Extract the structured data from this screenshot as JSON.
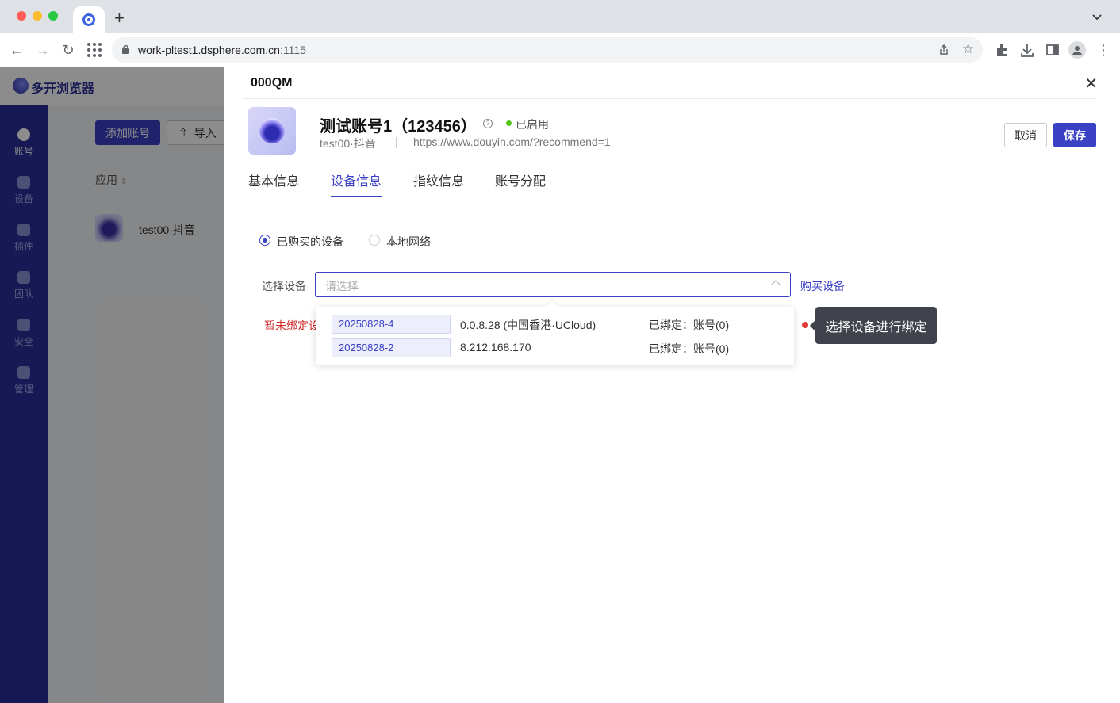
{
  "browser": {
    "url_host": "work-pltest1.dsphere.com.cn",
    "url_port": ":1115"
  },
  "app": {
    "logo_text": "多开浏览器",
    "nav": [
      {
        "label": "账号",
        "icon": "user-icon",
        "active": true
      },
      {
        "label": "设备",
        "icon": "wifi-icon",
        "active": false
      },
      {
        "label": "插件",
        "icon": "plugin-icon",
        "active": false
      },
      {
        "label": "团队",
        "icon": "team-icon",
        "active": false
      },
      {
        "label": "安全",
        "icon": "shield-icon",
        "active": false
      },
      {
        "label": "管理",
        "icon": "settings-icon",
        "active": false
      }
    ],
    "add_account": "添加账号",
    "import": "导入",
    "column_app": "应用",
    "row_name": "test00·抖音"
  },
  "drawer": {
    "title": "000QM",
    "close": "✕",
    "account_name": "测试账号1（123456）",
    "help": "?",
    "status": "已启用",
    "platform": "test00·抖音",
    "url": "https://www.douyin.com/?recommend=1",
    "cancel": "取消",
    "save": "保存",
    "tabs": [
      "基本信息",
      "设备信息",
      "指纹信息",
      "账号分配"
    ],
    "active_tab": "设备信息",
    "radio_options": [
      "已购买的设备",
      "本地网络"
    ],
    "radio_selected": "已购买的设备",
    "field_label": "选择设备",
    "select_placeholder": "请选择",
    "buy_link": "购买设备",
    "unbound_text": "暂未绑定设",
    "options": [
      {
        "tag": "20250828-4",
        "ip": "0.0.8.28 (中国香港·UCloud)",
        "bound": "已绑定：账号(0)"
      },
      {
        "tag": "20250828-2",
        "ip": "8.212.168.170",
        "bound": "已绑定：账号(0)"
      }
    ],
    "tooltip": "选择设备进行绑定"
  },
  "colors": {
    "accent": "#3b41c5",
    "sidebar": "#2b2f9a",
    "status_green": "#52c41a",
    "error_red": "#d42a2a",
    "tooltip_bg": "#41434c"
  }
}
